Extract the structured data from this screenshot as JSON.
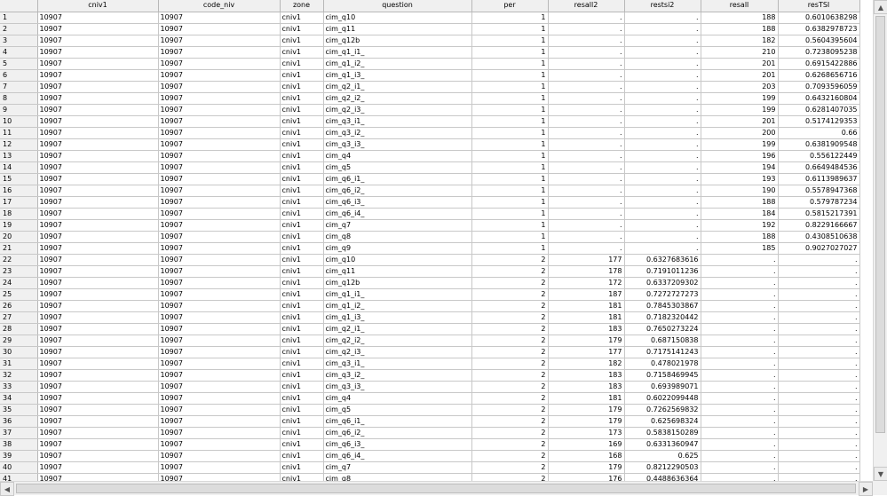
{
  "columns": [
    "cniv1",
    "code_niv",
    "zone",
    "question",
    "per",
    "resall2",
    "restsi2",
    "resall",
    "resTSI"
  ],
  "rows": [
    [
      "1",
      "10907",
      "10907",
      "cniv1",
      "cim_q10",
      "1",
      ".",
      ".",
      "188",
      "0.6010638298"
    ],
    [
      "2",
      "10907",
      "10907",
      "cniv1",
      "cim_q11",
      "1",
      ".",
      ".",
      "188",
      "0.6382978723"
    ],
    [
      "3",
      "10907",
      "10907",
      "cniv1",
      "cim_q12b",
      "1",
      ".",
      ".",
      "182",
      "0.5604395604"
    ],
    [
      "4",
      "10907",
      "10907",
      "cniv1",
      "cim_q1_i1_",
      "1",
      ".",
      ".",
      "210",
      "0.7238095238"
    ],
    [
      "5",
      "10907",
      "10907",
      "cniv1",
      "cim_q1_i2_",
      "1",
      ".",
      ".",
      "201",
      "0.6915422886"
    ],
    [
      "6",
      "10907",
      "10907",
      "cniv1",
      "cim_q1_i3_",
      "1",
      ".",
      ".",
      "201",
      "0.6268656716"
    ],
    [
      "7",
      "10907",
      "10907",
      "cniv1",
      "cim_q2_i1_",
      "1",
      ".",
      ".",
      "203",
      "0.7093596059"
    ],
    [
      "8",
      "10907",
      "10907",
      "cniv1",
      "cim_q2_i2_",
      "1",
      ".",
      ".",
      "199",
      "0.6432160804"
    ],
    [
      "9",
      "10907",
      "10907",
      "cniv1",
      "cim_q2_i3_",
      "1",
      ".",
      ".",
      "199",
      "0.6281407035"
    ],
    [
      "10",
      "10907",
      "10907",
      "cniv1",
      "cim_q3_i1_",
      "1",
      ".",
      ".",
      "201",
      "0.5174129353"
    ],
    [
      "11",
      "10907",
      "10907",
      "cniv1",
      "cim_q3_i2_",
      "1",
      ".",
      ".",
      "200",
      "0.66"
    ],
    [
      "12",
      "10907",
      "10907",
      "cniv1",
      "cim_q3_i3_",
      "1",
      ".",
      ".",
      "199",
      "0.6381909548"
    ],
    [
      "13",
      "10907",
      "10907",
      "cniv1",
      "cim_q4",
      "1",
      ".",
      ".",
      "196",
      "0.556122449"
    ],
    [
      "14",
      "10907",
      "10907",
      "cniv1",
      "cim_q5",
      "1",
      ".",
      ".",
      "194",
      "0.6649484536"
    ],
    [
      "15",
      "10907",
      "10907",
      "cniv1",
      "cim_q6_i1_",
      "1",
      ".",
      ".",
      "193",
      "0.6113989637"
    ],
    [
      "16",
      "10907",
      "10907",
      "cniv1",
      "cim_q6_i2_",
      "1",
      ".",
      ".",
      "190",
      "0.5578947368"
    ],
    [
      "17",
      "10907",
      "10907",
      "cniv1",
      "cim_q6_i3_",
      "1",
      ".",
      ".",
      "188",
      "0.579787234"
    ],
    [
      "18",
      "10907",
      "10907",
      "cniv1",
      "cim_q6_i4_",
      "1",
      ".",
      ".",
      "184",
      "0.5815217391"
    ],
    [
      "19",
      "10907",
      "10907",
      "cniv1",
      "cim_q7",
      "1",
      ".",
      ".",
      "192",
      "0.8229166667"
    ],
    [
      "20",
      "10907",
      "10907",
      "cniv1",
      "cim_q8",
      "1",
      ".",
      ".",
      "188",
      "0.4308510638"
    ],
    [
      "21",
      "10907",
      "10907",
      "cniv1",
      "cim_q9",
      "1",
      ".",
      ".",
      "185",
      "0.9027027027"
    ],
    [
      "22",
      "10907",
      "10907",
      "cniv1",
      "cim_q10",
      "2",
      "177",
      "0.6327683616",
      ".",
      "."
    ],
    [
      "23",
      "10907",
      "10907",
      "cniv1",
      "cim_q11",
      "2",
      "178",
      "0.7191011236",
      ".",
      "."
    ],
    [
      "24",
      "10907",
      "10907",
      "cniv1",
      "cim_q12b",
      "2",
      "172",
      "0.6337209302",
      ".",
      "."
    ],
    [
      "25",
      "10907",
      "10907",
      "cniv1",
      "cim_q1_i1_",
      "2",
      "187",
      "0.7272727273",
      ".",
      "."
    ],
    [
      "26",
      "10907",
      "10907",
      "cniv1",
      "cim_q1_i2_",
      "2",
      "181",
      "0.7845303867",
      ".",
      "."
    ],
    [
      "27",
      "10907",
      "10907",
      "cniv1",
      "cim_q1_i3_",
      "2",
      "181",
      "0.7182320442",
      ".",
      "."
    ],
    [
      "28",
      "10907",
      "10907",
      "cniv1",
      "cim_q2_i1_",
      "2",
      "183",
      "0.7650273224",
      ".",
      "."
    ],
    [
      "29",
      "10907",
      "10907",
      "cniv1",
      "cim_q2_i2_",
      "2",
      "179",
      "0.687150838",
      ".",
      "."
    ],
    [
      "30",
      "10907",
      "10907",
      "cniv1",
      "cim_q2_i3_",
      "2",
      "177",
      "0.7175141243",
      ".",
      "."
    ],
    [
      "31",
      "10907",
      "10907",
      "cniv1",
      "cim_q3_i1_",
      "2",
      "182",
      "0.478021978",
      ".",
      "."
    ],
    [
      "32",
      "10907",
      "10907",
      "cniv1",
      "cim_q3_i2_",
      "2",
      "183",
      "0.7158469945",
      ".",
      "."
    ],
    [
      "33",
      "10907",
      "10907",
      "cniv1",
      "cim_q3_i3_",
      "2",
      "183",
      "0.693989071",
      ".",
      "."
    ],
    [
      "34",
      "10907",
      "10907",
      "cniv1",
      "cim_q4",
      "2",
      "181",
      "0.6022099448",
      ".",
      "."
    ],
    [
      "35",
      "10907",
      "10907",
      "cniv1",
      "cim_q5",
      "2",
      "179",
      "0.7262569832",
      ".",
      "."
    ],
    [
      "36",
      "10907",
      "10907",
      "cniv1",
      "cim_q6_i1_",
      "2",
      "179",
      "0.625698324",
      ".",
      "."
    ],
    [
      "37",
      "10907",
      "10907",
      "cniv1",
      "cim_q6_i2_",
      "2",
      "173",
      "0.5838150289",
      ".",
      "."
    ],
    [
      "38",
      "10907",
      "10907",
      "cniv1",
      "cim_q6_i3_",
      "2",
      "169",
      "0.6331360947",
      ".",
      "."
    ],
    [
      "39",
      "10907",
      "10907",
      "cniv1",
      "cim_q6_i4_",
      "2",
      "168",
      "0.625",
      ".",
      "."
    ],
    [
      "40",
      "10907",
      "10907",
      "cniv1",
      "cim_q7",
      "2",
      "179",
      "0.8212290503",
      ".",
      "."
    ],
    [
      "41",
      "10907",
      "10907",
      "cniv1",
      "cim_q8",
      "2",
      "176",
      "0.4488636364",
      ".",
      "."
    ]
  ],
  "scrollbars": {
    "up_icon": "▲",
    "down_icon": "▼",
    "left_icon": "◀",
    "right_icon": "▶"
  }
}
